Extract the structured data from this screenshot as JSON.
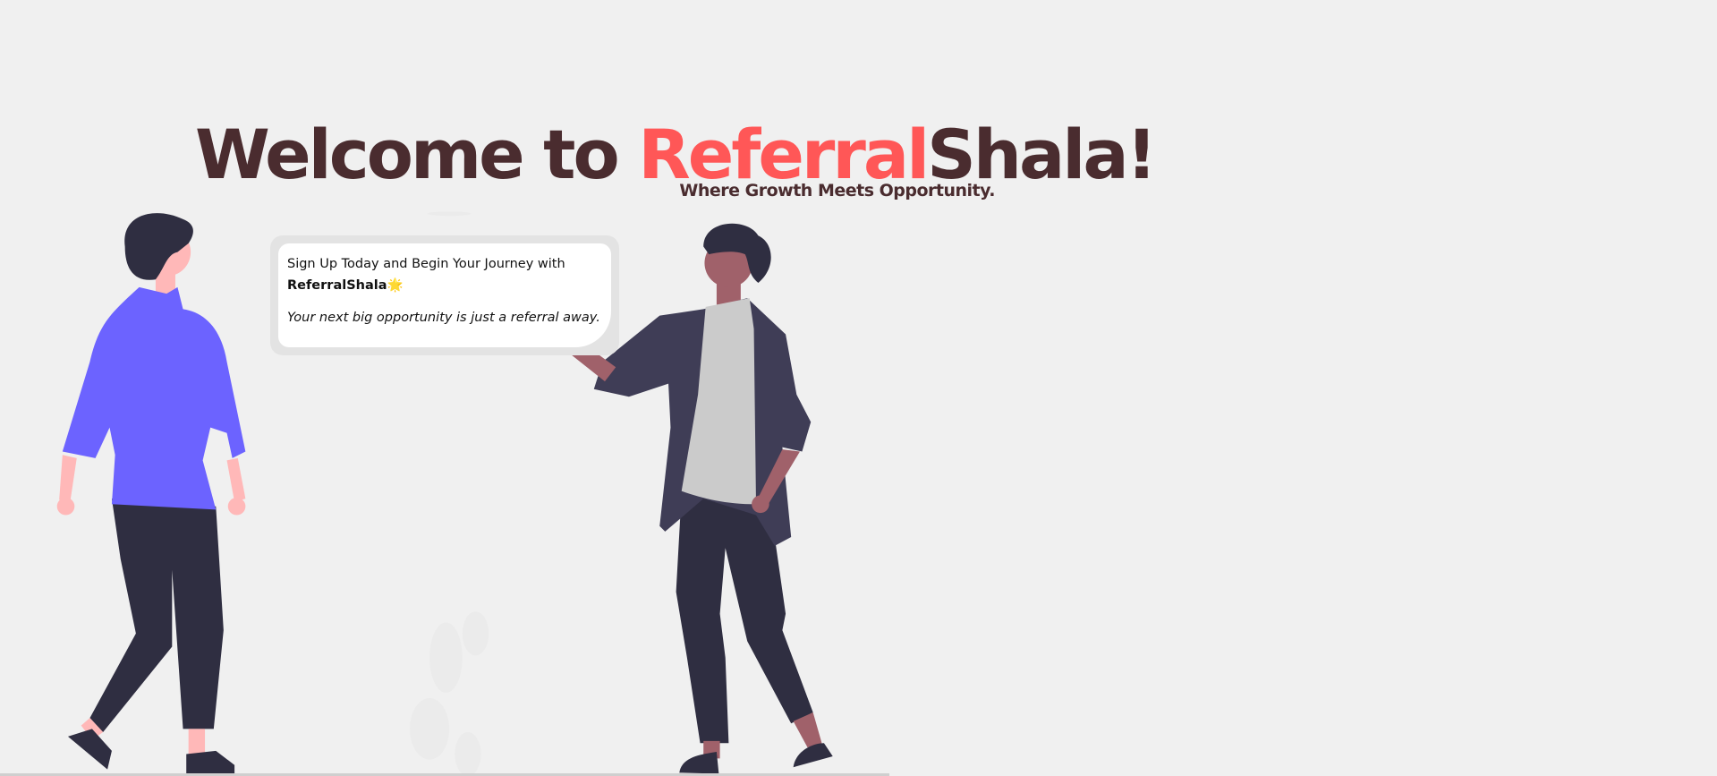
{
  "hero": {
    "title_prefix": "Welcome to ",
    "title_accent": "Referral",
    "title_suffix": "Shala!",
    "subtitle": "Where Growth Meets Opportunity."
  },
  "bubble": {
    "line1": "Sign Up Today and Begin Your Journey with",
    "brand": "ReferralShala",
    "emoji": "🌟",
    "tagline": "Your next big opportunity is just a referral away."
  },
  "colors": {
    "background": "#f0f0f0",
    "title": "#4a2c2f",
    "accent": "#ff5757",
    "shirt_left": "#6c63ff",
    "jacket_right": "#3f3d56",
    "pants": "#2f2e41"
  }
}
